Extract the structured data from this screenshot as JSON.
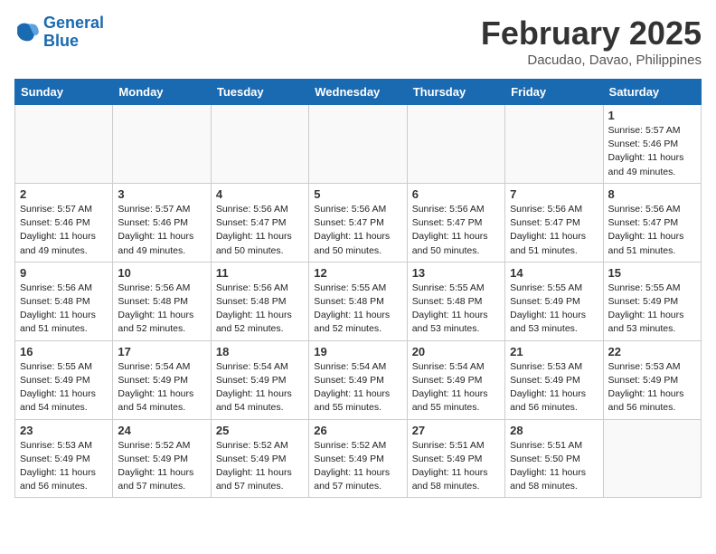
{
  "header": {
    "logo_line1": "General",
    "logo_line2": "Blue",
    "month_title": "February 2025",
    "location": "Dacudao, Davao, Philippines"
  },
  "weekdays": [
    "Sunday",
    "Monday",
    "Tuesday",
    "Wednesday",
    "Thursday",
    "Friday",
    "Saturday"
  ],
  "weeks": [
    [
      {
        "day": "",
        "info": ""
      },
      {
        "day": "",
        "info": ""
      },
      {
        "day": "",
        "info": ""
      },
      {
        "day": "",
        "info": ""
      },
      {
        "day": "",
        "info": ""
      },
      {
        "day": "",
        "info": ""
      },
      {
        "day": "1",
        "info": "Sunrise: 5:57 AM\nSunset: 5:46 PM\nDaylight: 11 hours\nand 49 minutes."
      }
    ],
    [
      {
        "day": "2",
        "info": "Sunrise: 5:57 AM\nSunset: 5:46 PM\nDaylight: 11 hours\nand 49 minutes."
      },
      {
        "day": "3",
        "info": "Sunrise: 5:57 AM\nSunset: 5:46 PM\nDaylight: 11 hours\nand 49 minutes."
      },
      {
        "day": "4",
        "info": "Sunrise: 5:56 AM\nSunset: 5:47 PM\nDaylight: 11 hours\nand 50 minutes."
      },
      {
        "day": "5",
        "info": "Sunrise: 5:56 AM\nSunset: 5:47 PM\nDaylight: 11 hours\nand 50 minutes."
      },
      {
        "day": "6",
        "info": "Sunrise: 5:56 AM\nSunset: 5:47 PM\nDaylight: 11 hours\nand 50 minutes."
      },
      {
        "day": "7",
        "info": "Sunrise: 5:56 AM\nSunset: 5:47 PM\nDaylight: 11 hours\nand 51 minutes."
      },
      {
        "day": "8",
        "info": "Sunrise: 5:56 AM\nSunset: 5:47 PM\nDaylight: 11 hours\nand 51 minutes."
      }
    ],
    [
      {
        "day": "9",
        "info": "Sunrise: 5:56 AM\nSunset: 5:48 PM\nDaylight: 11 hours\nand 51 minutes."
      },
      {
        "day": "10",
        "info": "Sunrise: 5:56 AM\nSunset: 5:48 PM\nDaylight: 11 hours\nand 52 minutes."
      },
      {
        "day": "11",
        "info": "Sunrise: 5:56 AM\nSunset: 5:48 PM\nDaylight: 11 hours\nand 52 minutes."
      },
      {
        "day": "12",
        "info": "Sunrise: 5:55 AM\nSunset: 5:48 PM\nDaylight: 11 hours\nand 52 minutes."
      },
      {
        "day": "13",
        "info": "Sunrise: 5:55 AM\nSunset: 5:48 PM\nDaylight: 11 hours\nand 53 minutes."
      },
      {
        "day": "14",
        "info": "Sunrise: 5:55 AM\nSunset: 5:49 PM\nDaylight: 11 hours\nand 53 minutes."
      },
      {
        "day": "15",
        "info": "Sunrise: 5:55 AM\nSunset: 5:49 PM\nDaylight: 11 hours\nand 53 minutes."
      }
    ],
    [
      {
        "day": "16",
        "info": "Sunrise: 5:55 AM\nSunset: 5:49 PM\nDaylight: 11 hours\nand 54 minutes."
      },
      {
        "day": "17",
        "info": "Sunrise: 5:54 AM\nSunset: 5:49 PM\nDaylight: 11 hours\nand 54 minutes."
      },
      {
        "day": "18",
        "info": "Sunrise: 5:54 AM\nSunset: 5:49 PM\nDaylight: 11 hours\nand 54 minutes."
      },
      {
        "day": "19",
        "info": "Sunrise: 5:54 AM\nSunset: 5:49 PM\nDaylight: 11 hours\nand 55 minutes."
      },
      {
        "day": "20",
        "info": "Sunrise: 5:54 AM\nSunset: 5:49 PM\nDaylight: 11 hours\nand 55 minutes."
      },
      {
        "day": "21",
        "info": "Sunrise: 5:53 AM\nSunset: 5:49 PM\nDaylight: 11 hours\nand 56 minutes."
      },
      {
        "day": "22",
        "info": "Sunrise: 5:53 AM\nSunset: 5:49 PM\nDaylight: 11 hours\nand 56 minutes."
      }
    ],
    [
      {
        "day": "23",
        "info": "Sunrise: 5:53 AM\nSunset: 5:49 PM\nDaylight: 11 hours\nand 56 minutes."
      },
      {
        "day": "24",
        "info": "Sunrise: 5:52 AM\nSunset: 5:49 PM\nDaylight: 11 hours\nand 57 minutes."
      },
      {
        "day": "25",
        "info": "Sunrise: 5:52 AM\nSunset: 5:49 PM\nDaylight: 11 hours\nand 57 minutes."
      },
      {
        "day": "26",
        "info": "Sunrise: 5:52 AM\nSunset: 5:49 PM\nDaylight: 11 hours\nand 57 minutes."
      },
      {
        "day": "27",
        "info": "Sunrise: 5:51 AM\nSunset: 5:49 PM\nDaylight: 11 hours\nand 58 minutes."
      },
      {
        "day": "28",
        "info": "Sunrise: 5:51 AM\nSunset: 5:50 PM\nDaylight: 11 hours\nand 58 minutes."
      },
      {
        "day": "",
        "info": ""
      }
    ]
  ]
}
